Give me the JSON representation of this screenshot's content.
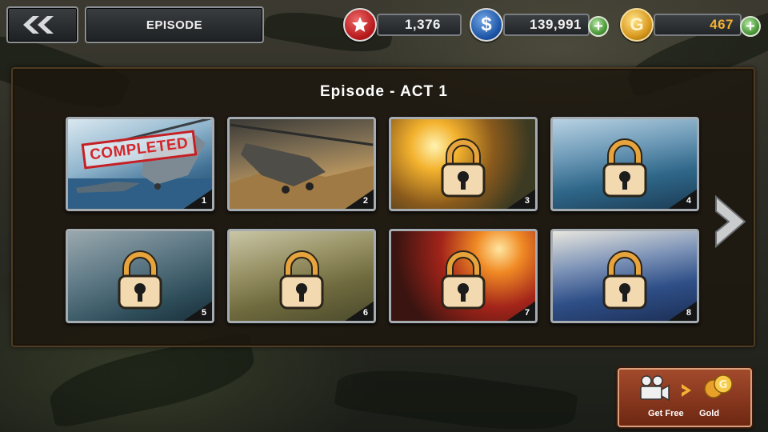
{
  "header": {
    "title": "EPISODE"
  },
  "currencies": {
    "stars": {
      "value": "1,376"
    },
    "cash": {
      "value": "139,991",
      "symbol": "$"
    },
    "gold": {
      "value": "467",
      "symbol": "G"
    }
  },
  "panel": {
    "title": "Episode - ACT 1"
  },
  "missions": [
    {
      "number": "1",
      "status": "completed",
      "stamp": "COMPLETED"
    },
    {
      "number": "2",
      "status": "unlocked"
    },
    {
      "number": "3",
      "status": "locked"
    },
    {
      "number": "4",
      "status": "locked"
    },
    {
      "number": "5",
      "status": "locked"
    },
    {
      "number": "6",
      "status": "locked"
    },
    {
      "number": "7",
      "status": "locked"
    },
    {
      "number": "8",
      "status": "locked"
    }
  ],
  "promo": {
    "left_label": "Get Free",
    "right_label": "Gold"
  },
  "colors": {
    "accent_gold": "#f2b233",
    "panel_border": "#4e3b22",
    "plus_green": "#4c9a3a",
    "stamp_red": "#c41f24"
  }
}
